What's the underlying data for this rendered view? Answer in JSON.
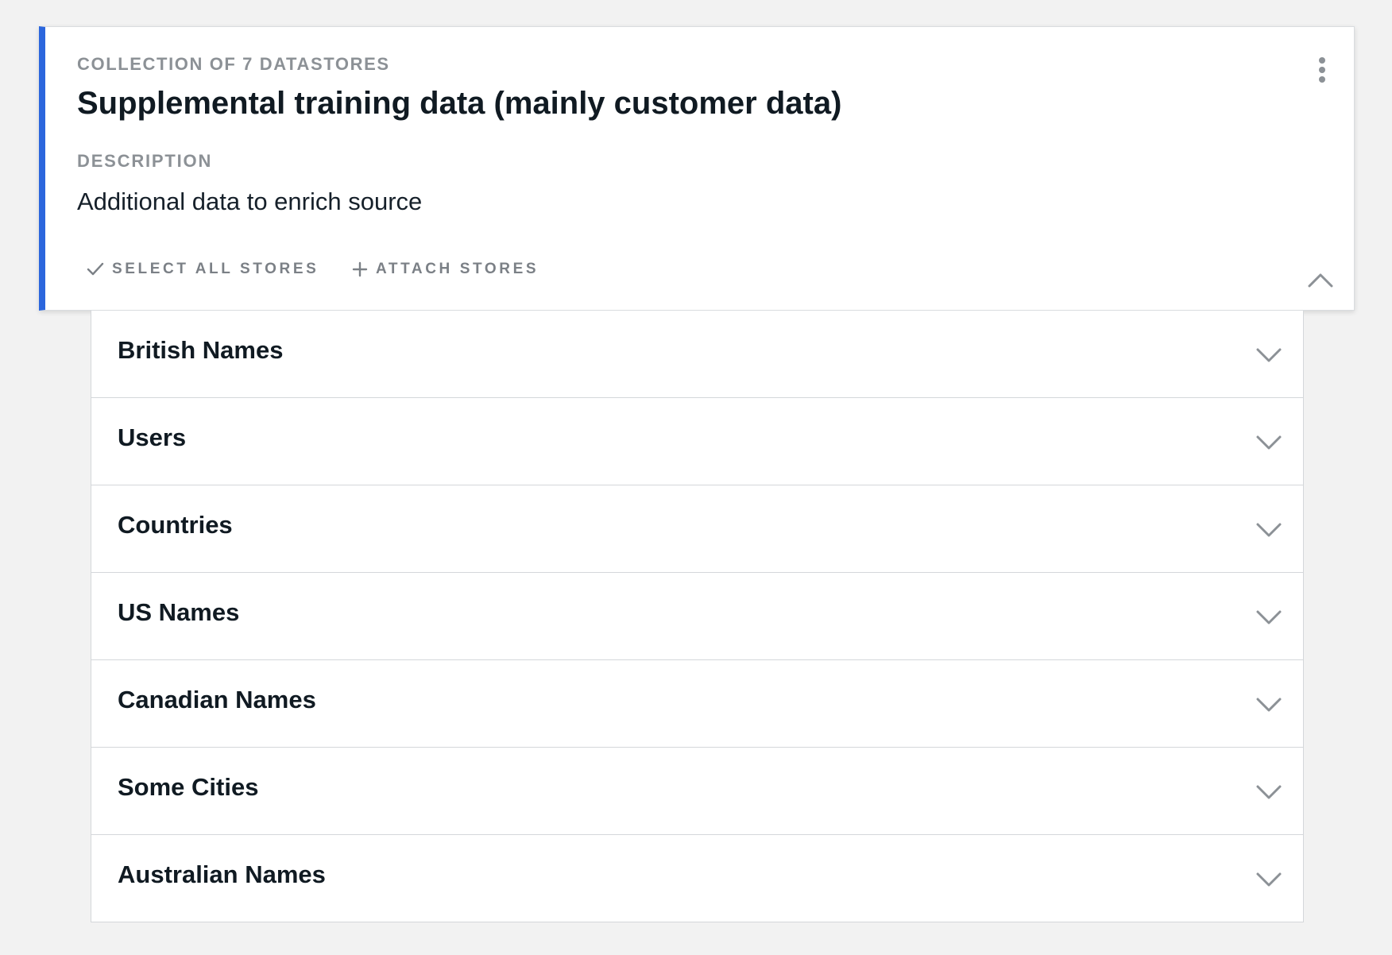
{
  "collection": {
    "eyebrow": "COLLECTION OF 7 DATASTORES",
    "title": "Supplemental training data (mainly customer data)",
    "description_label": "DESCRIPTION",
    "description": "Additional data to enrich source",
    "actions": {
      "select_all": "SELECT ALL STORES",
      "attach": "ATTACH STORES"
    },
    "accent_color": "#2b66dd"
  },
  "stores": [
    {
      "label": "British Names"
    },
    {
      "label": "Users"
    },
    {
      "label": "Countries"
    },
    {
      "label": "US Names"
    },
    {
      "label": "Canadian Names"
    },
    {
      "label": "Some Cities"
    },
    {
      "label": "Australian Names"
    }
  ],
  "icons": {
    "menu": "kebab-menu-icon",
    "collapse": "chevron-up-icon",
    "expand": "chevron-down-icon",
    "select": "check-icon",
    "attach": "plus-icon"
  }
}
